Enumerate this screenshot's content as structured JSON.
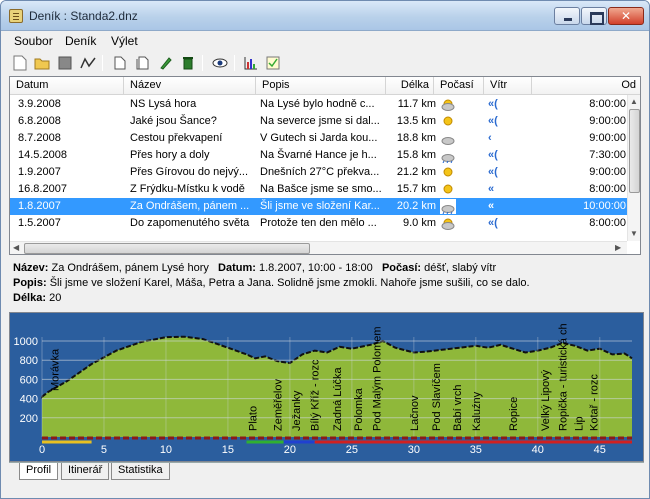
{
  "window": {
    "title": "Deník : Standa2.dnz"
  },
  "menu": [
    "Soubor",
    "Deník",
    "Výlet"
  ],
  "toolbar_icons": [
    "new-file-icon",
    "open-folder-icon",
    "save-icon",
    "route-icon",
    "document-icon",
    "copy-icon",
    "edit-pencil-icon",
    "trash-icon",
    "eye-icon",
    "chart-icon",
    "checklist-icon"
  ],
  "grid": {
    "columns": [
      "Datum",
      "Název",
      "Popis",
      "Délka",
      "Počasí",
      "Vítr",
      "Od"
    ],
    "rows": [
      {
        "datum": "3.9.2008",
        "nazev": "NS Lysá hora",
        "popis": "Na Lysé bylo hodně c...",
        "delka": "11.7 km",
        "pocasi": "cloudy",
        "vitr": "strong",
        "od": "8:00:00"
      },
      {
        "datum": "6.8.2008",
        "nazev": "Jaké jsou Šance?",
        "popis": "Na severce jsme si dal...",
        "delka": "13.5 km",
        "pocasi": "sunny",
        "vitr": "strong",
        "od": "9:00:00"
      },
      {
        "datum": "8.7.2008",
        "nazev": "Cestou překvapení",
        "popis": "V Gutech si Jarda kou...",
        "delka": "18.8 km",
        "pocasi": "cloud",
        "vitr": "weak",
        "od": "9:00:00"
      },
      {
        "datum": "14.5.2008",
        "nazev": "Přes hory a doly",
        "popis": "Na Švarné Hance je h...",
        "delka": "15.8 km",
        "pocasi": "rain",
        "vitr": "strong",
        "od": "7:30:00"
      },
      {
        "datum": "1.9.2007",
        "nazev": "Přes Gírovou do nejvý...",
        "popis": "Dnešních 27°C překva...",
        "delka": "21.2 km",
        "pocasi": "sunny",
        "vitr": "strong",
        "od": "9:00:00"
      },
      {
        "datum": "16.8.2007",
        "nazev": "Z Frýdku-Místku k vodě",
        "popis": "Na Bašce jsme se smo...",
        "delka": "15.7 km",
        "pocasi": "sunny",
        "vitr": "medium",
        "od": "8:00:00"
      },
      {
        "datum": "1.8.2007",
        "nazev": "Za Ondrášem, pánem ...",
        "popis": "Šli jsme ve složení Kar...",
        "delka": "20.2 km",
        "pocasi": "rain",
        "vitr": "medium",
        "od": "10:00:00",
        "selected": true
      },
      {
        "datum": "1.5.2007",
        "nazev": "Do zapomenutého světa",
        "popis": "Protože ten den mělo ...",
        "delka": "9.0 km",
        "pocasi": "cloudy",
        "vitr": "strong",
        "od": "8:00:00"
      }
    ]
  },
  "detail": {
    "nazev_label": "Název:",
    "nazev": "Za Ondrášem, pánem Lysé hory",
    "datum_label": "Datum:",
    "datum": "1.8.2007, 10:00 - 18:00",
    "pocasi_label": "Počasí:",
    "pocasi": "déšť, slabý vítr",
    "popis_label": "Popis:",
    "popis": "Šli jsme ve složení Karel, Máša, Petra a Jana. Solidně jsme zmokli. Nahoře jsme sušili, co se dalo.",
    "delka_label": "Délka:",
    "delka": "20"
  },
  "profile": {
    "y_ticks": [
      "1000",
      "800",
      "600",
      "400",
      "200"
    ],
    "x_ticks": [
      "0",
      "5",
      "10",
      "15",
      "20",
      "25",
      "30",
      "35",
      "40",
      "45"
    ],
    "places": [
      "Morávka",
      "Plato",
      "Zeměřelov",
      "Ježanky",
      "Bílý Kříž - rozc",
      "Zadná Lúčka",
      "Polomka",
      "Pod Malým Polomem",
      "Lačnov",
      "Pod Slavíčem",
      "Babí vrch",
      "Kaluźny",
      "Ropice",
      "Velký Lipový",
      "Ropička - turistická ch",
      "Lip",
      "Kotař - rozc"
    ],
    "colors": {
      "sky": "#2b5e9e",
      "terrain": "#8fb83a"
    }
  },
  "tabs": [
    "Profil",
    "Itinerář",
    "Statistika"
  ]
}
